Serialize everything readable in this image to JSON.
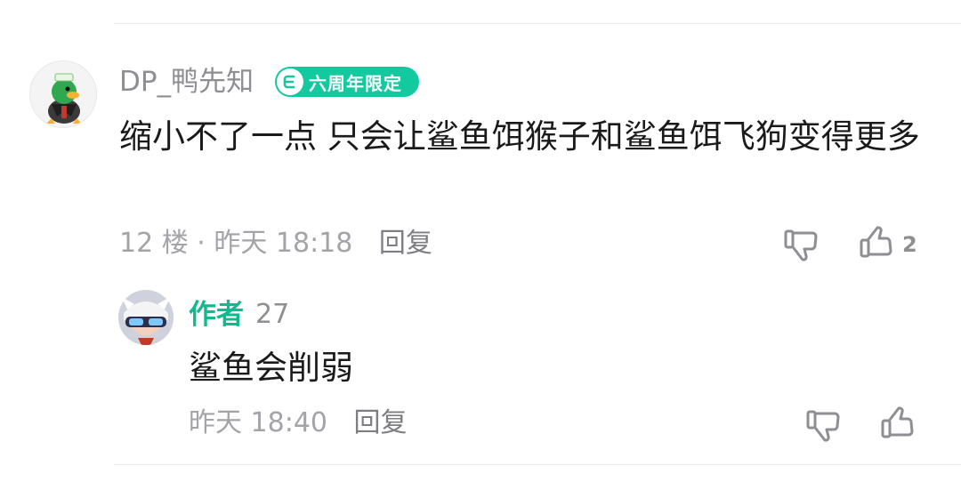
{
  "comment": {
    "username": "DP_鸭先知",
    "badge_label": "六周年限定",
    "text": "缩小不了一点 只会让鲨鱼饵猴子和鲨鱼饵飞狗变得更多",
    "floor": "12 楼",
    "separator": "·",
    "time": "昨天 18:18",
    "reply_label": "回复",
    "like_count": "2"
  },
  "reply": {
    "author_label": "作者",
    "username": "27",
    "text": "鲨鱼会削弱",
    "time": "昨天 18:40",
    "reply_label": "回复"
  },
  "icons": {
    "dislike": "thumbs-down-icon",
    "like": "thumbs-up-icon",
    "badge": "anniversary-badge-icon"
  },
  "colors": {
    "accent": "#12c9a0",
    "author": "#12b98f",
    "meta": "#a3a3a8",
    "text": "#1a1a1a"
  }
}
